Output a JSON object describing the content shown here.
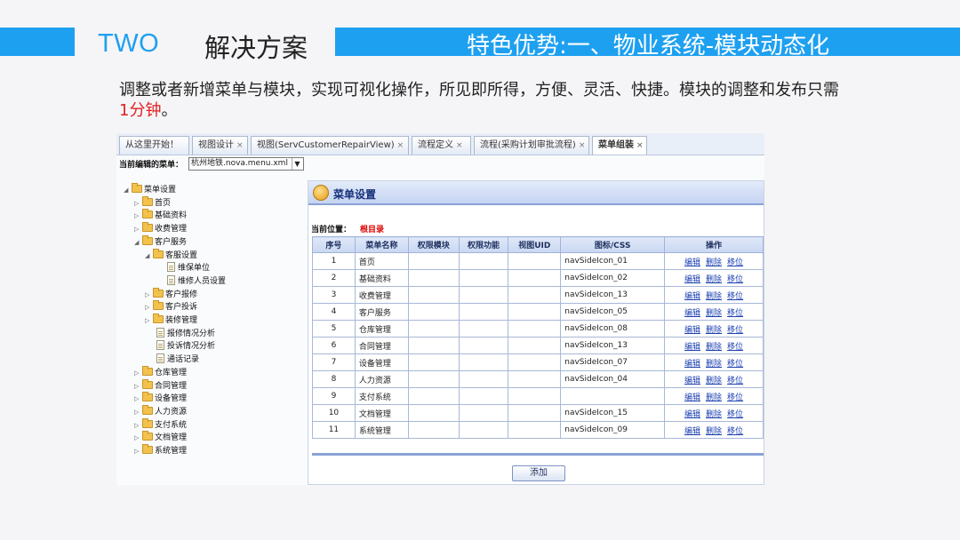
{
  "slide": {
    "label": "TWO",
    "section_title": "解决方案",
    "feature_title": "特色优势:一、物业系统-模块动态化",
    "desc_text": "调整或者新增菜单与模块，实现可视化操作，所见即所得，方便、灵活、快捷。模块的调整和发布只需",
    "desc_highlight": "1分钟",
    "desc_end": "。",
    "accent_color": "#1ea0f0",
    "highlight_color": "#e02020"
  },
  "tabs": [
    {
      "label": "从这里开始！",
      "closable": false
    },
    {
      "label": "视图设计",
      "closable": true
    },
    {
      "label": "视图(ServCustomerRepairView)",
      "closable": true
    },
    {
      "label": "流程定义",
      "closable": true
    },
    {
      "label": "流程(采购计划审批流程)",
      "closable": true
    },
    {
      "label": "菜单组装",
      "closable": true,
      "active": true
    }
  ],
  "editor": {
    "current_menu_label": "当前编辑的菜单：",
    "current_menu_value": "杭州地铁.nova.menu.xml"
  },
  "tree": [
    {
      "label": "菜单设置",
      "type": "folder",
      "expanded": true
    },
    {
      "label": "首页",
      "type": "folder"
    },
    {
      "label": "基础资料",
      "type": "folder"
    },
    {
      "label": "收费管理",
      "type": "folder"
    },
    {
      "label": "客户服务",
      "type": "folder",
      "expanded": true
    },
    {
      "label": "客服设置",
      "type": "folder",
      "expanded": true
    },
    {
      "label": "维保单位",
      "type": "file"
    },
    {
      "label": "维修人员设置",
      "type": "file"
    },
    {
      "label": "客户报修",
      "type": "folder"
    },
    {
      "label": "客户投诉",
      "type": "folder"
    },
    {
      "label": "装修管理",
      "type": "folder"
    },
    {
      "label": "报修情况分析",
      "type": "file"
    },
    {
      "label": "投诉情况分析",
      "type": "file"
    },
    {
      "label": "通话记录",
      "type": "file"
    },
    {
      "label": "仓库管理",
      "type": "folder"
    },
    {
      "label": "合同管理",
      "type": "folder"
    },
    {
      "label": "设备管理",
      "type": "folder"
    },
    {
      "label": "人力资源",
      "type": "folder"
    },
    {
      "label": "支付系统",
      "type": "folder"
    },
    {
      "label": "文档管理",
      "type": "folder"
    },
    {
      "label": "系统管理",
      "type": "folder"
    }
  ],
  "panel": {
    "title": "菜单设置",
    "location_label": "当前位置：",
    "location_value": "根目录",
    "columns": [
      "序号",
      "菜单名称",
      "权限模块",
      "权限功能",
      "视图UID",
      "图标/CSS",
      "操作"
    ],
    "rows": [
      [
        "1",
        "首页",
        "",
        "",
        "",
        "navSideIcon_01"
      ],
      [
        "2",
        "基础资料",
        "",
        "",
        "",
        "navSideIcon_02"
      ],
      [
        "3",
        "收费管理",
        "",
        "",
        "",
        "navSideIcon_13"
      ],
      [
        "4",
        "客户服务",
        "",
        "",
        "",
        "navSideIcon_05"
      ],
      [
        "5",
        "仓库管理",
        "",
        "",
        "",
        "navSideIcon_08"
      ],
      [
        "6",
        "合同管理",
        "",
        "",
        "",
        "navSideIcon_13"
      ],
      [
        "7",
        "设备管理",
        "",
        "",
        "",
        "navSideIcon_07"
      ],
      [
        "8",
        "人力资源",
        "",
        "",
        "",
        "navSideIcon_04"
      ],
      [
        "9",
        "支付系统",
        "",
        "",
        "",
        ""
      ],
      [
        "10",
        "文档管理",
        "",
        "",
        "",
        "navSideIcon_15"
      ],
      [
        "11",
        "系统管理",
        "",
        "",
        "",
        "navSideIcon_09"
      ]
    ],
    "ops": [
      "编辑",
      "删除",
      "移位"
    ],
    "add_label": "添加"
  }
}
